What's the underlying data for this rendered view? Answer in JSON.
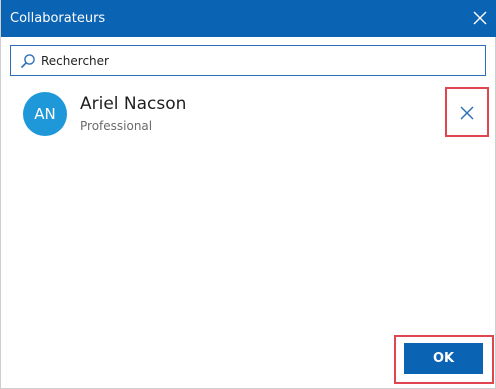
{
  "dialog": {
    "title": "Collaborateurs"
  },
  "search": {
    "placeholder": "Rechercher",
    "value": ""
  },
  "collaborators": [
    {
      "initials": "AN",
      "name": "Ariel Nacson",
      "role": "Professional"
    }
  ],
  "actions": {
    "ok_label": "OK"
  },
  "icons": {
    "close": "close-icon",
    "search": "search-icon",
    "remove": "remove-icon"
  },
  "colors": {
    "titlebar": "#0b63b3",
    "avatar": "#1e98d8",
    "highlight": "#e0464f",
    "ok_button": "#0b63b3"
  }
}
